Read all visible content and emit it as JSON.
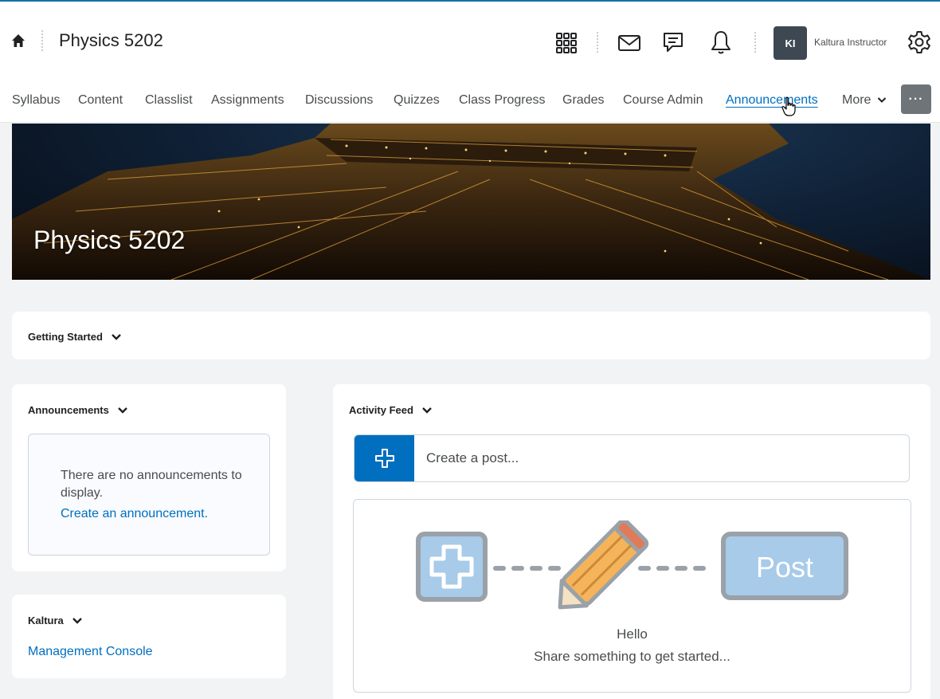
{
  "header": {
    "course_title": "Physics 5202",
    "user_initials": "KI",
    "user_name": "Kaltura Instructor",
    "icons": [
      "home-icon",
      "apps-grid-icon",
      "mail-icon",
      "chat-icon",
      "bell-icon",
      "gear-icon"
    ]
  },
  "nav": {
    "items": [
      {
        "label": "Syllabus"
      },
      {
        "label": "Content"
      },
      {
        "label": "Classlist"
      },
      {
        "label": "Assignments"
      },
      {
        "label": "Discussions"
      },
      {
        "label": "Quizzes"
      },
      {
        "label": "Class Progress"
      },
      {
        "label": "Grades"
      },
      {
        "label": "Course Admin"
      },
      {
        "label": "Announcements",
        "active": true
      },
      {
        "label": "More"
      }
    ],
    "overflow_label": "···"
  },
  "banner": {
    "title": "Physics 5202"
  },
  "widgets": {
    "getting_started": {
      "heading": "Getting Started"
    },
    "announcements": {
      "heading": "Announcements",
      "empty_text": "There are no announcements to display.",
      "create_link": "Create an announcement."
    },
    "kaltura": {
      "heading": "Kaltura",
      "link": "Management Console"
    },
    "activity_feed": {
      "heading": "Activity Feed",
      "placeholder": "Create a post...",
      "illustration_label": "Post",
      "hello": "Hello",
      "share": "Share something to get started..."
    }
  },
  "colors": {
    "accent": "#006fbf",
    "page_bg": "#f1f3f4",
    "avatar_bg": "#3e4853",
    "top_border": "#1a6fa3"
  }
}
